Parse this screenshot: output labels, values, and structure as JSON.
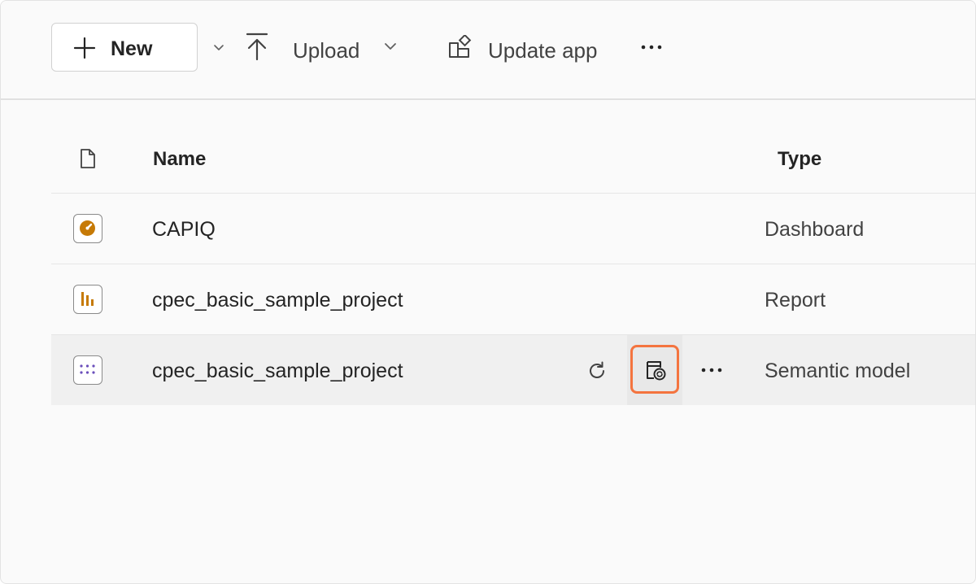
{
  "toolbar": {
    "new_label": "New",
    "upload_label": "Upload",
    "update_app_label": "Update app"
  },
  "table": {
    "columns": {
      "name": "Name",
      "type": "Type"
    },
    "rows": [
      {
        "name": "CAPIQ",
        "type": "Dashboard",
        "icon": "dashboard-icon"
      },
      {
        "name": "cpec_basic_sample_project",
        "type": "Report",
        "icon": "report-icon"
      },
      {
        "name": "cpec_basic_sample_project",
        "type": "Semantic model",
        "icon": "semantic-model-icon"
      }
    ]
  },
  "colors": {
    "highlight": "#f4743f",
    "dashboard_accent": "#c67a06",
    "report_accent": "#c67a06",
    "semantic_accent": "#6b4fbb"
  }
}
